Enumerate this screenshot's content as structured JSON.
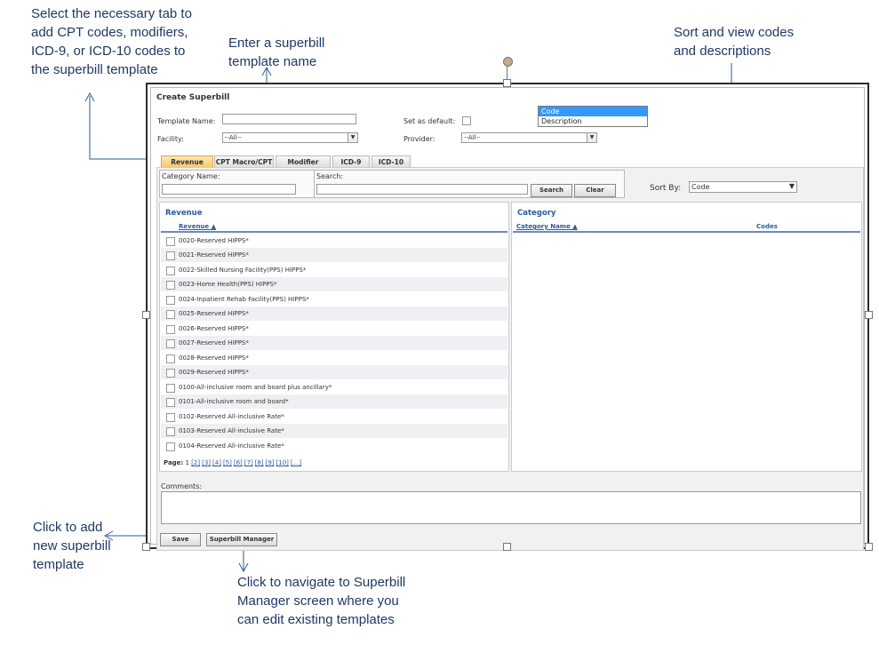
{
  "callouts": {
    "tabs_note": "Select the necessary tab to\nadd CPT codes, modifiers,\nICD-9, or ICD-10 codes to\nthe superbill template",
    "name_note": "Enter a superbill\ntemplate name",
    "sort_note": "Sort and view codes\nand descriptions",
    "save_note": "Click to add\nnew superbill\ntemplate",
    "manager_note": "Click to navigate to Superbill\nManager screen where you\ncan edit existing templates"
  },
  "form": {
    "title": "Create Superbill",
    "template_name_label": "Template Name:",
    "template_name_value": "",
    "set_default_label": "Set as default:",
    "facility_label": "Facility:",
    "facility_value": "--All--",
    "provider_label": "Provider:",
    "provider_value": "--All--"
  },
  "tabs": [
    {
      "label": "Revenue",
      "active": true
    },
    {
      "label": "CPT Macro/CPT",
      "active": false
    },
    {
      "label": "Modifier",
      "active": false
    },
    {
      "label": "ICD-9",
      "active": false
    },
    {
      "label": "ICD-10",
      "active": false
    }
  ],
  "filters": {
    "category_name_label": "Category Name:",
    "search_label": "Search:",
    "search_button": "Search",
    "clear_button": "Clear",
    "sort_by_label": "Sort By:",
    "sort_value": "Code",
    "sort_options": [
      "Code",
      "Description"
    ]
  },
  "revenue_panel": {
    "title": "Revenue",
    "column": "Revenue",
    "rows": [
      "0020-Reserved HIPPS*",
      "0021-Reserved HIPPS*",
      "0022-Skilled Nursing Facility(PPS) HIPPS*",
      "0023-Home Health(PPS) HIPPS*",
      "0024-Inpatient Rehab Facility(PPS) HIPPS*",
      "0025-Reserved HIPPS*",
      "0026-Reserved HIPPS*",
      "0027-Reserved HIPPS*",
      "0028-Reserved HIPPS*",
      "0029-Reserved HIPPS*",
      "0100-All-inclusive room and board plus ancillary*",
      "0101-All-inclusive room and board*",
      "0102-Reserved All-inclusive Rate*",
      "0103-Reserved All-inclusive Rate*",
      "0104-Reserved All-inclusive Rate*"
    ],
    "page_label": "Page:",
    "current_page": "1",
    "pages": [
      "[2]",
      "[3]",
      "[4]",
      "[5]",
      "[6]",
      "[7]",
      "[8]",
      "[9]",
      "[10]",
      "[...]"
    ]
  },
  "category_panel": {
    "title": "Category",
    "col_name": "Category Name",
    "col_codes": "Codes"
  },
  "comments_label": "Comments:",
  "buttons": {
    "save": "Save",
    "manager": "Superbill Manager"
  },
  "colors": {
    "callout_text": "#1f3864",
    "callout_line": "#2e5597",
    "active_tab": "#f6c66c",
    "link": "#2b5aa0",
    "dropdown_highlight": "#3399ff"
  }
}
